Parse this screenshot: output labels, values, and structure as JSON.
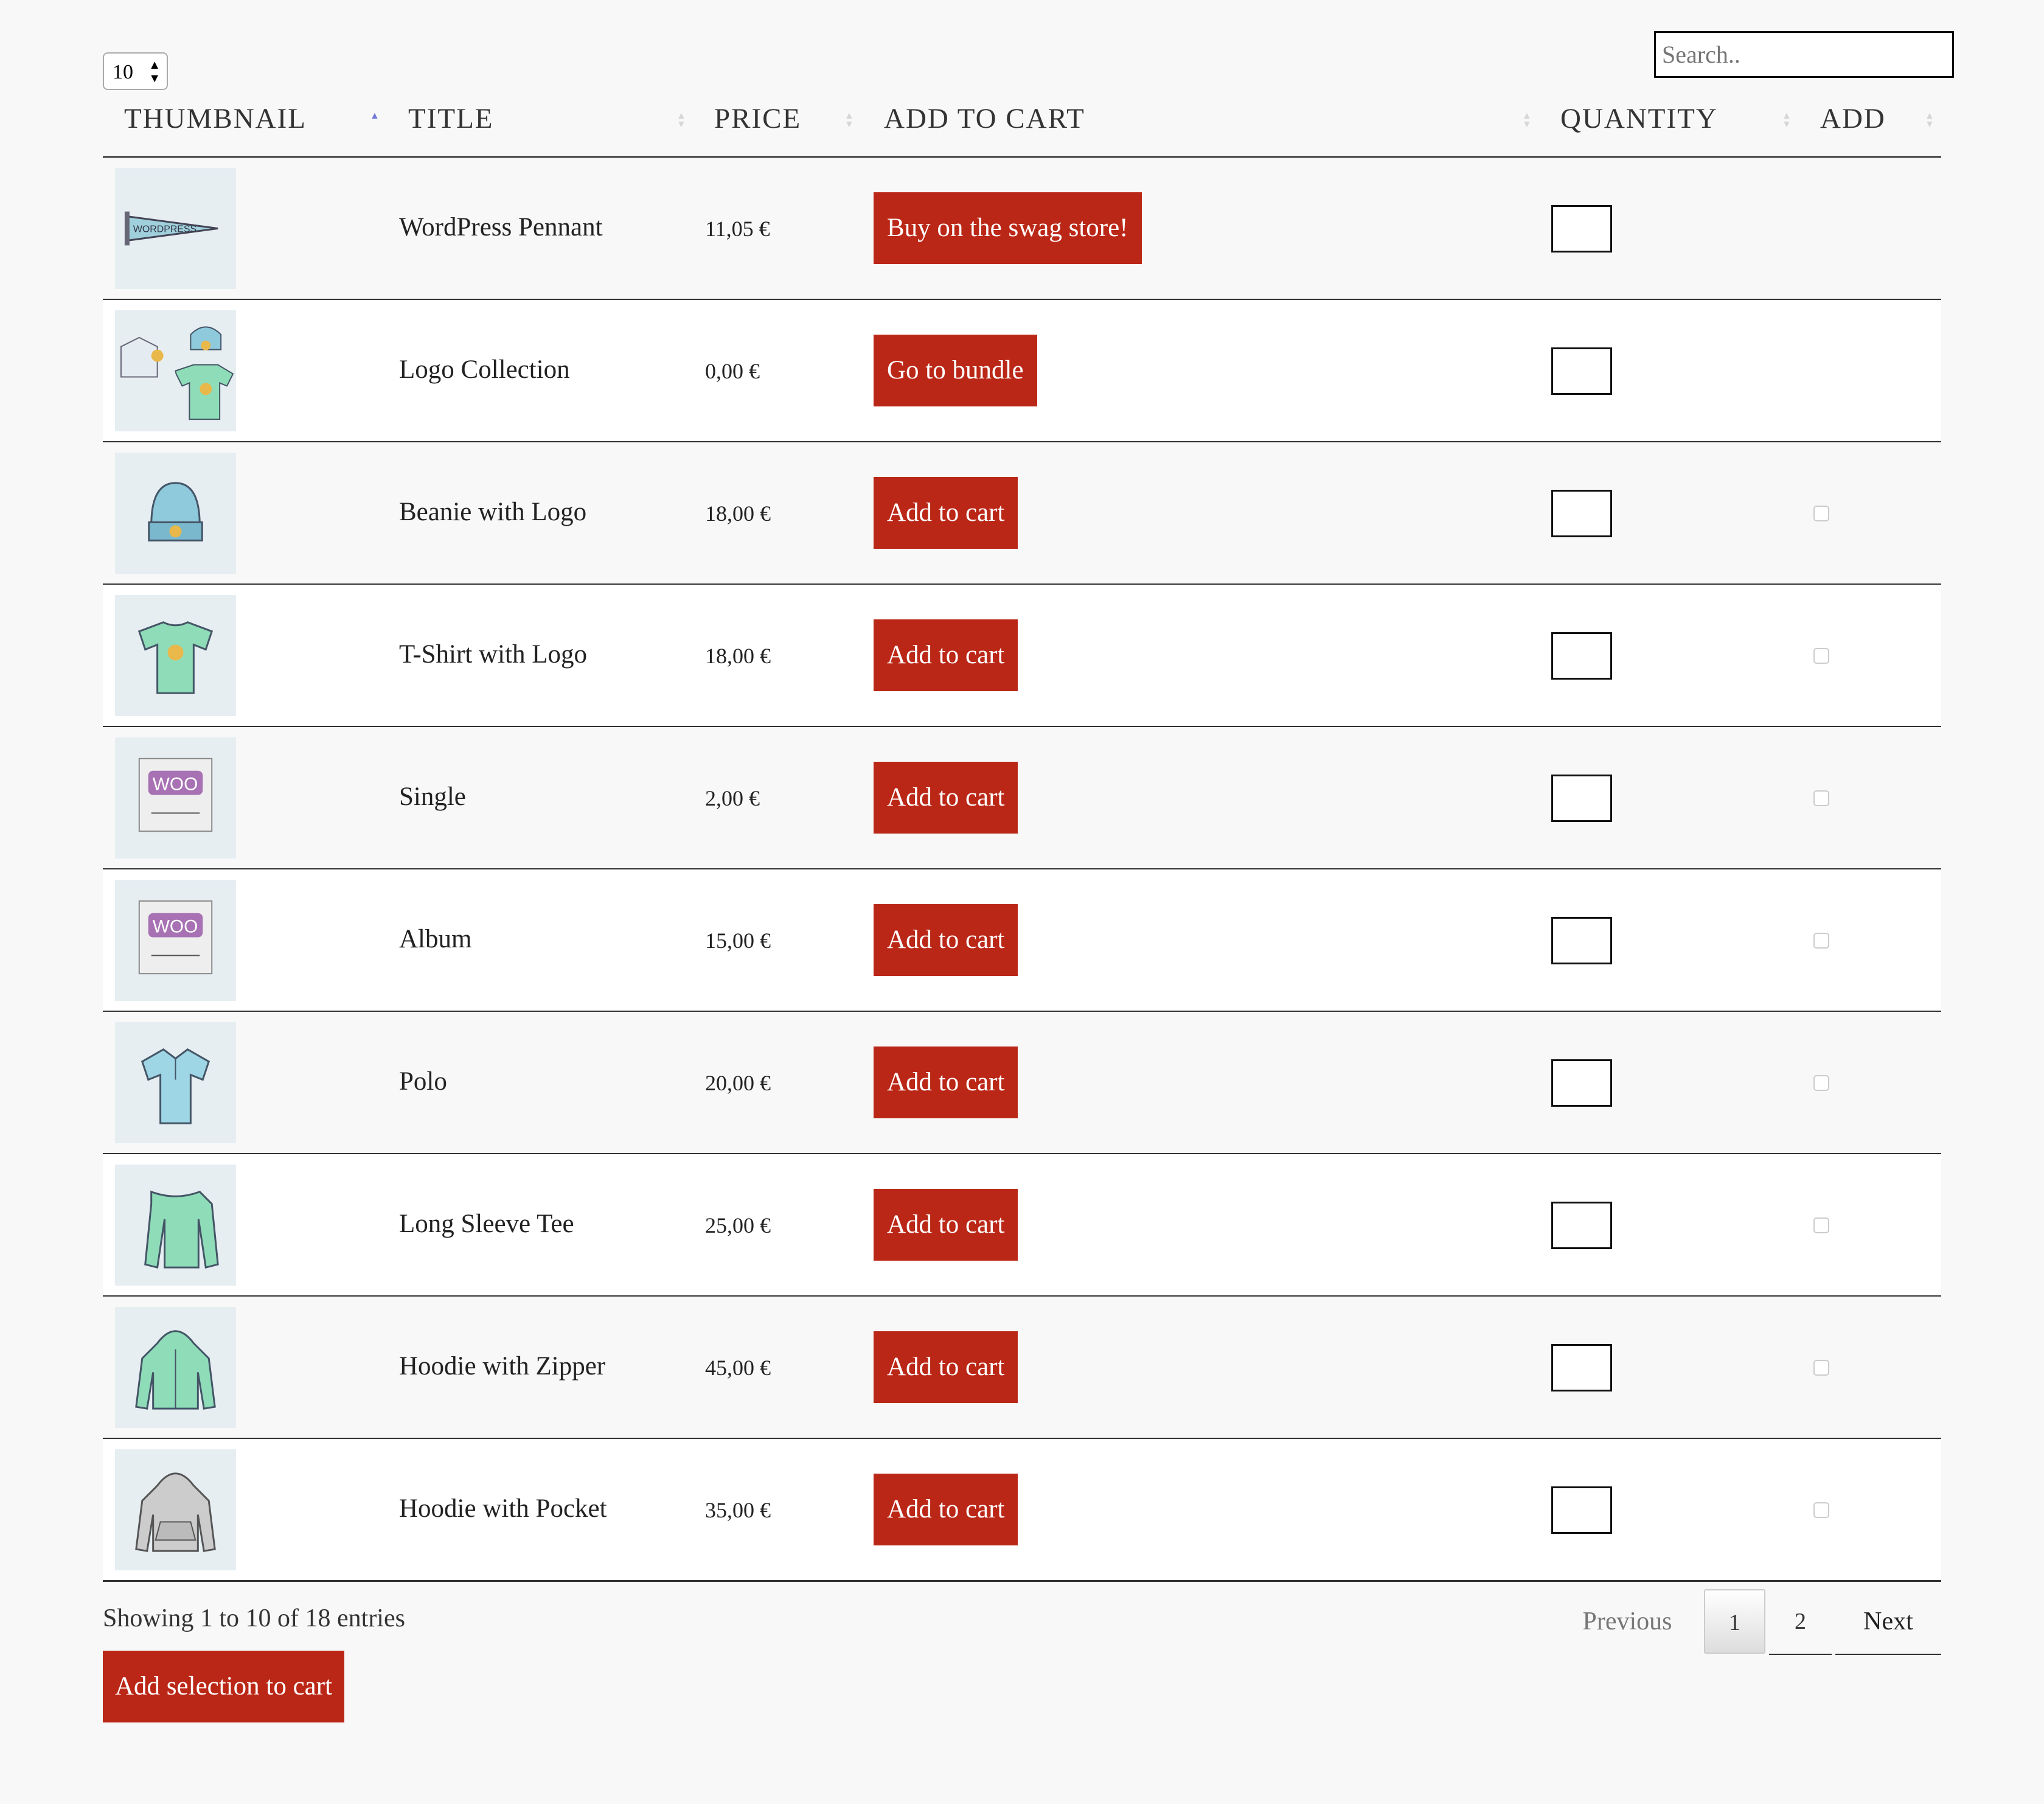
{
  "length_select": {
    "value": "10"
  },
  "search": {
    "placeholder": "Search.."
  },
  "columns": [
    {
      "label": "THUMBNAIL",
      "sort": "asc"
    },
    {
      "label": "TITLE",
      "sort": "none"
    },
    {
      "label": "PRICE",
      "sort": "none"
    },
    {
      "label": "ADD TO CART",
      "sort": "none"
    },
    {
      "label": "QUANTITY",
      "sort": "none"
    },
    {
      "label": "ADD",
      "sort": "none"
    }
  ],
  "rows": [
    {
      "thumb": "pennant",
      "title": "WordPress Pennant",
      "price": "11,05 €",
      "button": "Buy on the swag store!",
      "checkbox": false
    },
    {
      "thumb": "logo-collection",
      "title": "Logo Collection",
      "price": "0,00 €",
      "button": "Go to bundle",
      "checkbox": false
    },
    {
      "thumb": "beanie",
      "title": "Beanie with Logo",
      "price": "18,00 €",
      "button": "Add to cart",
      "checkbox": true
    },
    {
      "thumb": "tshirt",
      "title": "T-Shirt with Logo",
      "price": "18,00 €",
      "button": "Add to cart",
      "checkbox": true
    },
    {
      "thumb": "woo-single",
      "title": "Single",
      "price": "2,00 €",
      "button": "Add to cart",
      "checkbox": true
    },
    {
      "thumb": "woo-album",
      "title": "Album",
      "price": "15,00 €",
      "button": "Add to cart",
      "checkbox": true
    },
    {
      "thumb": "polo",
      "title": "Polo",
      "price": "20,00 €",
      "button": "Add to cart",
      "checkbox": true
    },
    {
      "thumb": "long-sleeve",
      "title": "Long Sleeve Tee",
      "price": "25,00 €",
      "button": "Add to cart",
      "checkbox": true
    },
    {
      "thumb": "hoodie-zipper",
      "title": "Hoodie with Zipper",
      "price": "45,00 €",
      "button": "Add to cart",
      "checkbox": true
    },
    {
      "thumb": "hoodie-pocket",
      "title": "Hoodie with Pocket",
      "price": "35,00 €",
      "button": "Add to cart",
      "checkbox": true
    }
  ],
  "footer": {
    "info": "Showing 1 to 10 of 18 entries",
    "add_selection": "Add selection to cart",
    "pagination": {
      "previous": "Previous",
      "pages": [
        "1",
        "2"
      ],
      "current": "1",
      "next": "Next"
    }
  },
  "colors": {
    "accent": "#bb2717",
    "background": "#f8f8f8",
    "sort_active": "#7279d8"
  }
}
